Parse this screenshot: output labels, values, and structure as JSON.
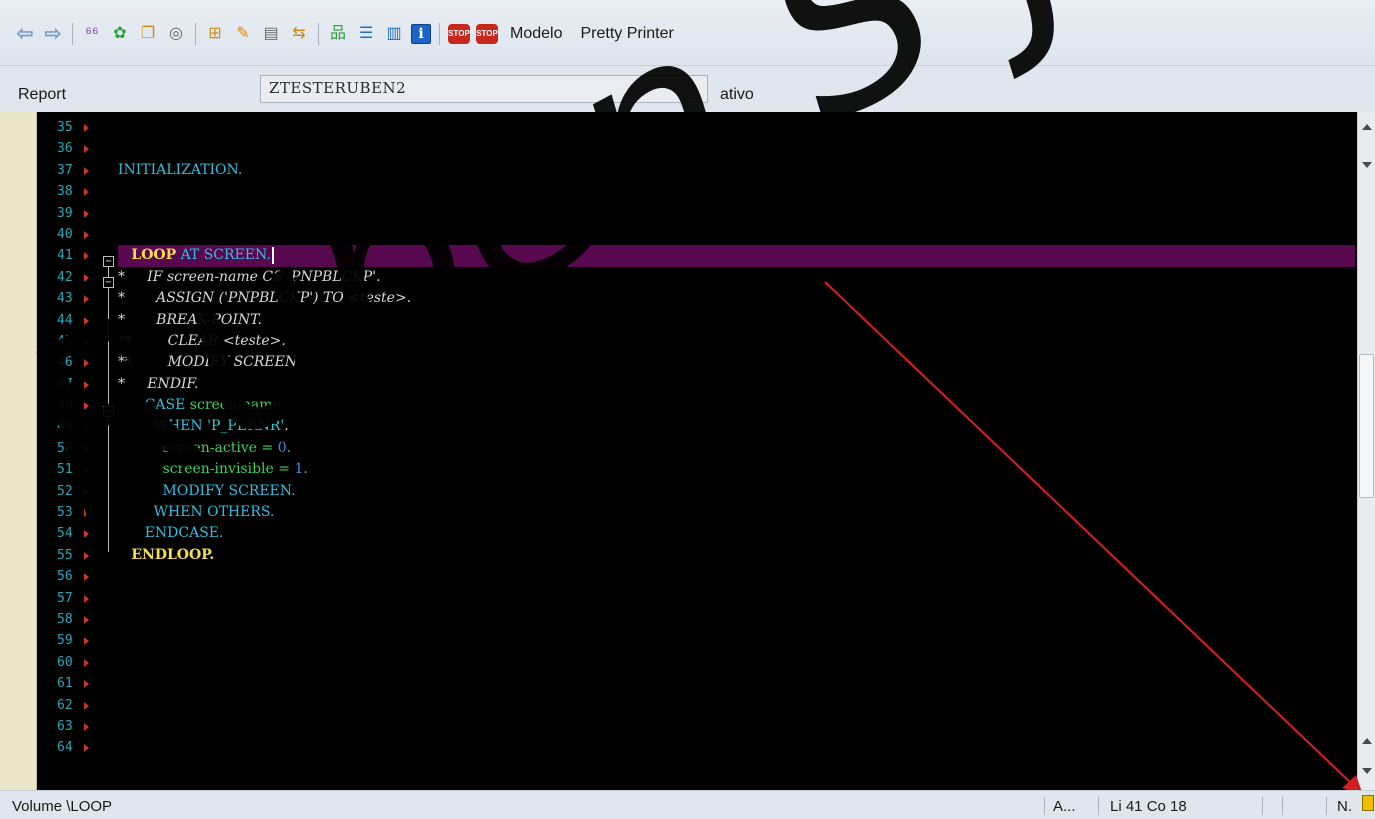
{
  "toolbar": {
    "modelo_label": "Modelo",
    "pretty_printer_label": "Pretty Printer",
    "icons": [
      "back-arrow-icon",
      "forward-arrow-icon",
      "glasses-icon",
      "objects-icon",
      "copy-icon",
      "spiral-icon",
      "hierarchy-icon",
      "wand-icon",
      "display-icon",
      "transport-icon",
      "tree-icon",
      "align-icon",
      "list-icon",
      "info-icon",
      "stop-icon",
      "stop-red-icon"
    ]
  },
  "report": {
    "label": "Report",
    "name": "ZTESTERUBEN2",
    "status": "ativo"
  },
  "editor": {
    "line_numbers": [
      "35",
      "36",
      "37",
      "38",
      "39",
      "40",
      "41",
      "42",
      "43",
      "44",
      "45",
      "46",
      "47",
      "48",
      "49",
      "50",
      "51",
      "52",
      "53",
      "54",
      "55",
      "56",
      "57",
      "58",
      "59",
      "60",
      "61",
      "62",
      "63",
      "64"
    ],
    "code": {
      "l37": "INITIALIZATION.",
      "l41_kw": "LOOP",
      "l41_rest": " AT SCREEN.",
      "l42": "*     IF screen-name CS 'PNPBLCKP'.",
      "l43": "*       ASSIGN ('PNPBLCKP') TO <teste>.",
      "l44": "*       BREAK-POINT.",
      "l45": "**        CLEAR <teste>.",
      "l46": "**        MODIFY SCREEN.",
      "l47": "*     ENDIF.",
      "l48_kw": "CASE",
      "l48_rest": " screen-name.",
      "l49_kw": "WHEN",
      "l49_str": "'P_PERNR'",
      "l50_a": "screen-active",
      "l50_n": "0",
      "l51_a": "screen-invisible",
      "l51_n": "1",
      "l52": "MODIFY SCREEN.",
      "l53_kw": "WHEN",
      "l53_rest": " OTHERS.",
      "l54": "ENDCASE.",
      "l55": "ENDLOOP."
    }
  },
  "statusbar": {
    "left": "Volume \\LOOP",
    "mode": "A...",
    "position": "Li  41 Co  18",
    "ins": "N."
  },
  "watermark": "Ruben S Jardi"
}
